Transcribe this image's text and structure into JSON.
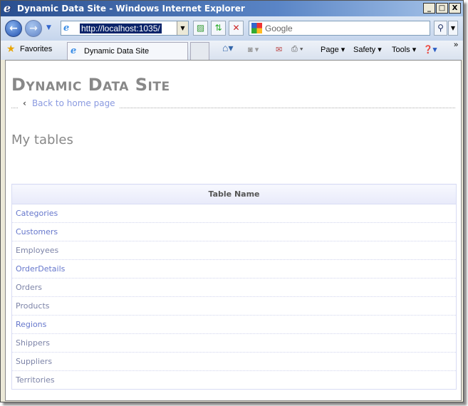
{
  "window": {
    "title": "Dynamic Data Site - Windows Internet Explorer",
    "minimize": "_",
    "maximize": "□",
    "close": "X"
  },
  "nav": {
    "url": "http://localhost:1035/",
    "search_placeholder": "Google"
  },
  "toolbar": {
    "favorites": "Favorites",
    "tab_title": "Dynamic Data Site",
    "page": "Page ▾",
    "safety": "Safety ▾",
    "tools": "Tools ▾",
    "more": "»"
  },
  "page": {
    "site_title": "Dynamic Data Site",
    "back_link": "Back to home page",
    "heading": "My tables",
    "table": {
      "header": "Table Name",
      "rows": [
        {
          "name": "Categories",
          "visited": false
        },
        {
          "name": "Customers",
          "visited": false
        },
        {
          "name": "Employees",
          "visited": true
        },
        {
          "name": "OrderDetails",
          "visited": false
        },
        {
          "name": "Orders",
          "visited": true
        },
        {
          "name": "Products",
          "visited": true
        },
        {
          "name": "Regions",
          "visited": false
        },
        {
          "name": "Shippers",
          "visited": true
        },
        {
          "name": "Suppliers",
          "visited": true
        },
        {
          "name": "Territories",
          "visited": true
        }
      ]
    }
  },
  "colors": {
    "link": "#6677cc",
    "visited": "#7d84a8",
    "title": "#888888"
  }
}
